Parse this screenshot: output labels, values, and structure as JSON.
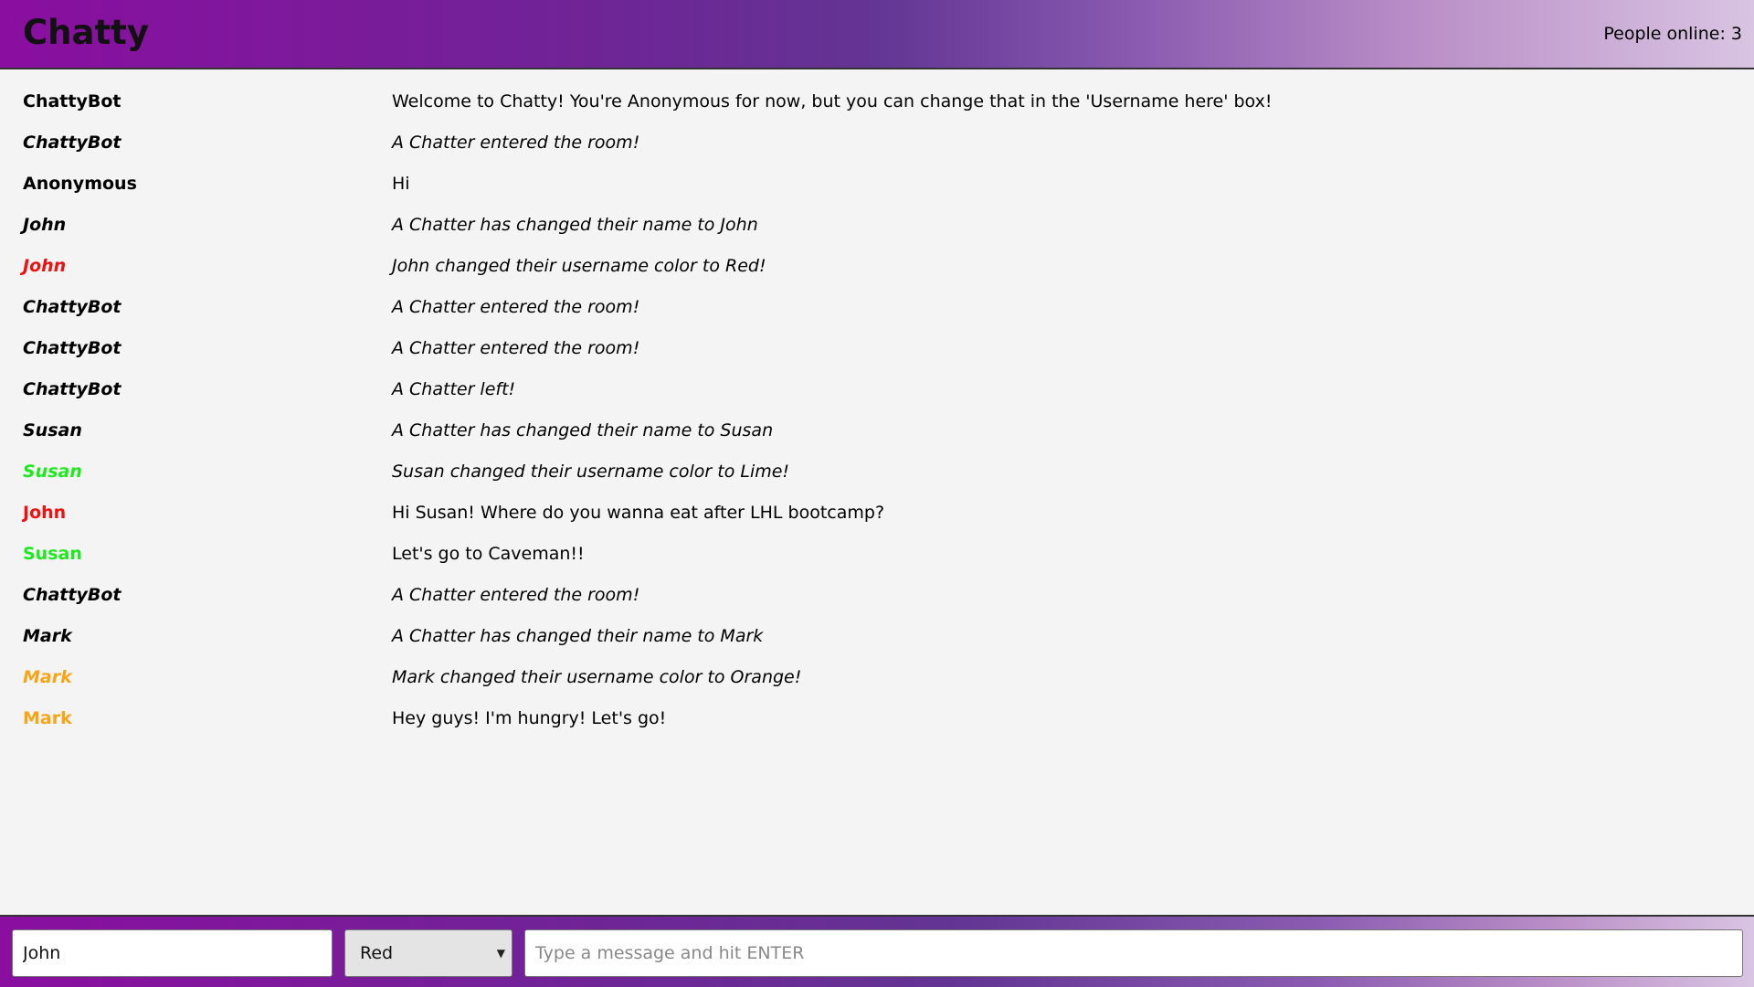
{
  "header": {
    "brand": "Chatty",
    "online": "People online: 3"
  },
  "messages": [
    {
      "user": "ChattyBot",
      "text": "Welcome to Chatty! You're Anonymous for now, but you can change that in the 'Username here' box!",
      "color": "#000000",
      "notice": false
    },
    {
      "user": "ChattyBot",
      "text": "A Chatter entered the room!",
      "color": "#000000",
      "notice": true
    },
    {
      "user": "Anonymous",
      "text": "Hi",
      "color": "#000000",
      "notice": false
    },
    {
      "user": "John",
      "text": "A Chatter has changed their name to John",
      "color": "#000000",
      "notice": true
    },
    {
      "user": "John",
      "text": "John changed their username color to Red!",
      "color": "#ee1111",
      "notice": true
    },
    {
      "user": "ChattyBot",
      "text": "A Chatter entered the room!",
      "color": "#000000",
      "notice": true
    },
    {
      "user": "ChattyBot",
      "text": "A Chatter entered the room!",
      "color": "#000000",
      "notice": true
    },
    {
      "user": "ChattyBot",
      "text": "A Chatter left!",
      "color": "#000000",
      "notice": true
    },
    {
      "user": "Susan",
      "text": "A Chatter has changed their name to Susan",
      "color": "#000000",
      "notice": true
    },
    {
      "user": "Susan",
      "text": "Susan changed their username color to Lime!",
      "color": "#1ee81e",
      "notice": true
    },
    {
      "user": "John",
      "text": "Hi Susan! Where do you wanna eat after LHL bootcamp?",
      "color": "#ee1111",
      "notice": false
    },
    {
      "user": "Susan",
      "text": "Let's go to Caveman!!",
      "color": "#1ee81e",
      "notice": false
    },
    {
      "user": "ChattyBot",
      "text": "A Chatter entered the room!",
      "color": "#000000",
      "notice": true
    },
    {
      "user": "Mark",
      "text": "A Chatter has changed their name to Mark",
      "color": "#000000",
      "notice": true
    },
    {
      "user": "Mark",
      "text": "Mark changed their username color to Orange!",
      "color": "#f5a516",
      "notice": true
    },
    {
      "user": "Mark",
      "text": "Hey guys! I'm hungry! Let's go!",
      "color": "#f5a516",
      "notice": false
    }
  ],
  "composer": {
    "username_value": "John",
    "color_selected": "Red",
    "message_placeholder": "Type a message and hit ENTER",
    "select_icon": "caret-down-icon"
  }
}
